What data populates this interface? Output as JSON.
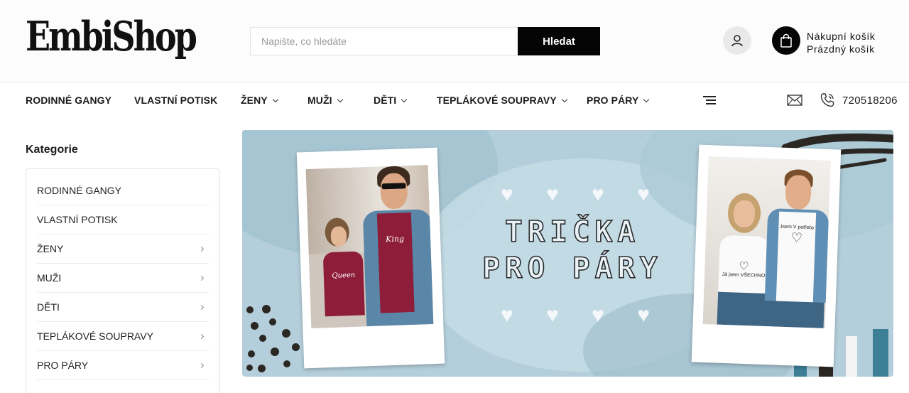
{
  "header": {
    "logo": "EmbiShop",
    "search": {
      "placeholder": "Napište, co hledáte",
      "button": "Hledat"
    },
    "cart": {
      "title": "Nákupní košík",
      "status": "Prázdný košík"
    }
  },
  "nav": {
    "items": [
      {
        "label": "RODINNÉ GANGY",
        "dropdown": false
      },
      {
        "label": "VLASTNÍ POTISK",
        "dropdown": false
      },
      {
        "label": "ŽENY",
        "dropdown": true
      },
      {
        "label": "MUŽI",
        "dropdown": true
      },
      {
        "label": "DĚTI",
        "dropdown": true
      },
      {
        "label": "TEPLÁKOVÉ SOUPRAVY",
        "dropdown": true
      },
      {
        "label": "PRO PÁRY",
        "dropdown": true
      }
    ],
    "phone": "720518206"
  },
  "sidebar": {
    "title": "Kategorie",
    "items": [
      {
        "label": "RODINNÉ GANGY",
        "has_children": false
      },
      {
        "label": "VLASTNÍ POTISK",
        "has_children": false
      },
      {
        "label": "ŽENY",
        "has_children": true
      },
      {
        "label": "MUŽI",
        "has_children": true
      },
      {
        "label": "DĚTI",
        "has_children": true
      },
      {
        "label": "TEPLÁKOVÉ SOUPRAVY",
        "has_children": true
      },
      {
        "label": "PRO PÁRY",
        "has_children": true
      }
    ]
  },
  "banner": {
    "title_line1": "TRIČKA",
    "title_line2": "PRO PÁRY",
    "left_photo_shirt_texts": [
      "Queen",
      "King"
    ],
    "right_photo_shirt_texts": [
      "Já jsem VŠECHNO",
      "Jsem V potřeby"
    ],
    "colors": {
      "background": "#b4cfdb",
      "accent_dark": "#2b2723",
      "accent_teal": "#3d7f97"
    }
  },
  "icons": {
    "account": "user-icon",
    "cart": "shopping-bag-icon",
    "menu": "hamburger-icon",
    "mail": "mail-icon",
    "phone": "phone-icon"
  }
}
